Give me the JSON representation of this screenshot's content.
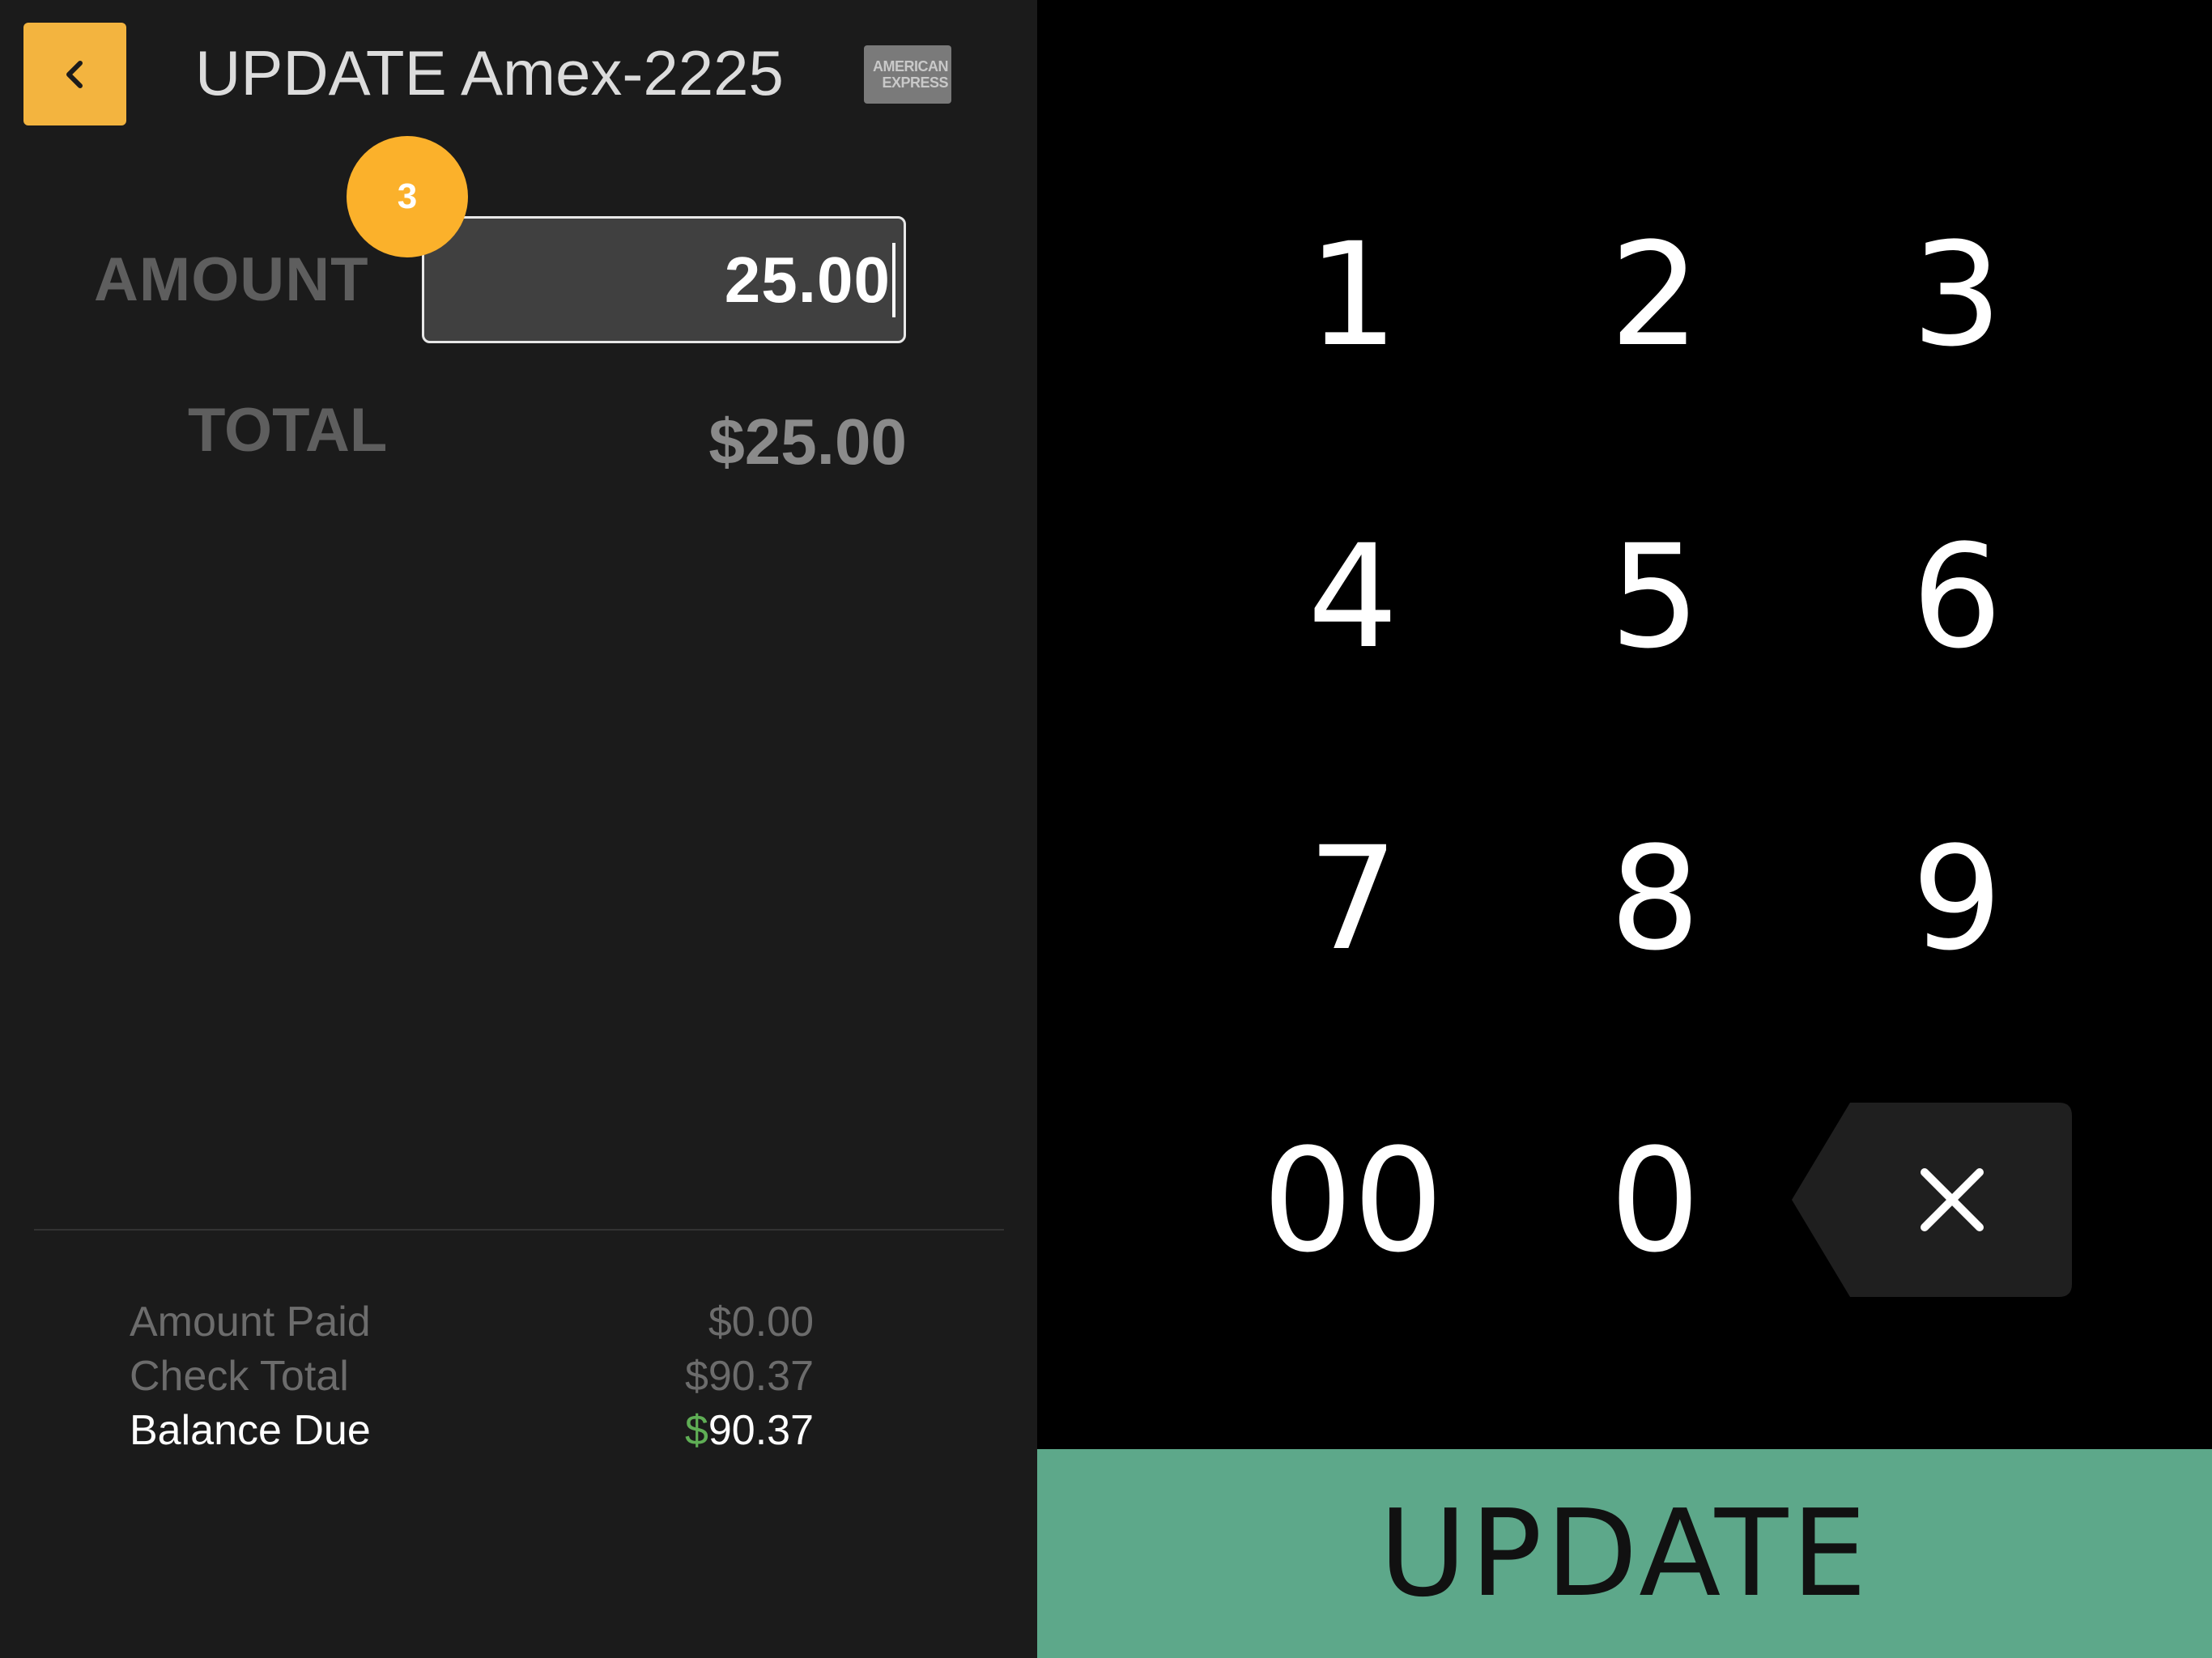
{
  "header": {
    "title": "UPDATE Amex-2225",
    "card_brand_line1": "AMERICAN",
    "card_brand_line2": "EXPRESS",
    "back_icon": "chevron-left-icon"
  },
  "form": {
    "amount_label": "AMOUNT",
    "amount_value": "25.00",
    "step_badge": "3",
    "total_label": "TOTAL",
    "total_value": "$25.00"
  },
  "summary": {
    "amount_paid_label": "Amount Paid",
    "amount_paid_value": "$0.00",
    "check_total_label": "Check Total",
    "check_total_value": "$90.37",
    "balance_due_label": "Balance Due",
    "balance_due_currency": "$",
    "balance_due_value": "90.37"
  },
  "keypad": {
    "keys": [
      "1",
      "2",
      "3",
      "4",
      "5",
      "6",
      "7",
      "8",
      "9",
      "00",
      "0"
    ],
    "backspace_icon": "backspace-icon"
  },
  "actions": {
    "update_label": "UPDATE"
  },
  "colors": {
    "accent_yellow": "#f3b43f",
    "badge_orange": "#fbb12b",
    "update_green": "#5da88a",
    "dollar_green": "#5fae55"
  }
}
